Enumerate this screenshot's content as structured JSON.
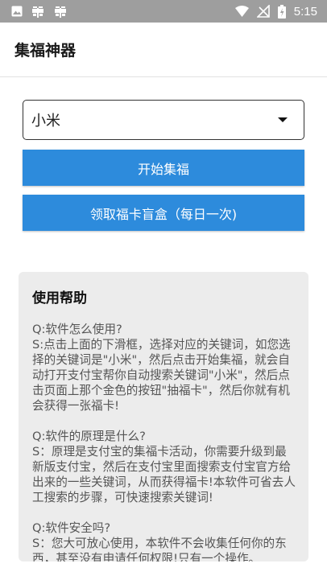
{
  "status_bar": {
    "time": "5:15",
    "left_icons": [
      "image-icon",
      "bug-icon",
      "bug-icon"
    ],
    "right_icons": [
      "wifi-icon",
      "no-signal-icon",
      "battery-icon"
    ]
  },
  "app_bar": {
    "title": "集福神器"
  },
  "keyword_select": {
    "value": "小米"
  },
  "buttons": {
    "start": "开始集福",
    "free_box": "领取福卡盲盒（每日一次)"
  },
  "help": {
    "title": "使用帮助",
    "content": "Q:软件怎么使用?\nS:点击上面的下滑框，选择对应的关键词，如您选择的关键词是\"小米\"，然后点击开始集福，就会自动打开支付宝帮你自动搜索关键词\"小米\"，然后点击页面上那个金色的按钮\"抽福卡\"，然后你就有机会获得一张福卡!\n\nQ:软件的原理是什么?\nS：原理是支付宝的集福卡活动，你需要升级到最新版支付宝，然后在支付宝里面搜索支付宝官方给出来的一些关键词，从而获得福卡!本软件可省去人工搜索的步骤，可快速搜索关键词!\n\nQ:软件安全吗?\nS：您大可放心使用，本软件不会收集任何你的东西，甚至没有申请任何权限!只有一个操作。"
  },
  "colors": {
    "status_bar": "#9e9e9e",
    "button": "#2d8bdc",
    "help_background": "#ececec"
  }
}
